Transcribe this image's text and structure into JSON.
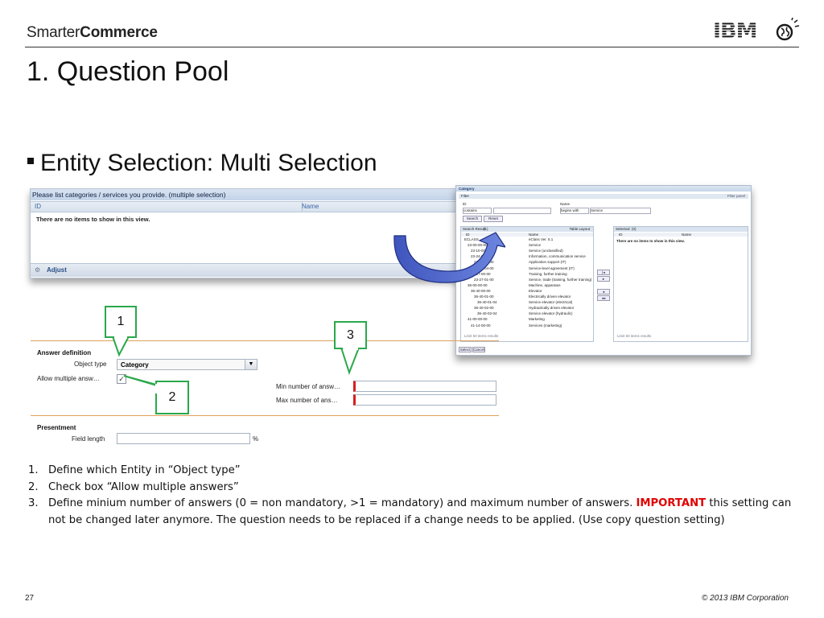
{
  "header": {
    "brand_prefix": "Smarter",
    "brand_suffix": "Commerce",
    "ibm_logo_text": "IBM"
  },
  "title": "1. Question Pool",
  "bullet": "Entity Selection: Multi Selection",
  "list_panel": {
    "title": "Please list categories / services you provide. (multiple selection)",
    "columns": [
      "ID",
      "Name"
    ],
    "empty_text": "There are no items to show in this view.",
    "footer_button": "Adjust"
  },
  "category_dialog": {
    "title": "Category",
    "filter_section": "Filter",
    "filter_action": "Filter panel",
    "id_label": "ID",
    "id_operator": "contains",
    "name_label": "Name",
    "name_operator": "begins with",
    "name_value": "Service",
    "search_button": "Search",
    "reset_button": "Reset",
    "search_result_title": "Search Result",
    "search_result_count": "(1)",
    "table_layout": "Table Layout",
    "selected_title": "Selected",
    "selected_count": "(0)",
    "columns": [
      "ID",
      "Name"
    ],
    "rows": [
      {
        "id": "ECLASS",
        "name": "eClass Ver. 5.1"
      },
      {
        "id": "23-00-00-00",
        "name": "Service"
      },
      {
        "id": "23-10-00-00",
        "name": "Service (unclassified)"
      },
      {
        "id": "23-24-00-00",
        "name": "Information, communication service"
      },
      {
        "id": "23-24-01-00",
        "name": "Application support (IT)"
      },
      {
        "id": "23-24-04-00",
        "name": "Service-level agreement (IT)"
      },
      {
        "id": "23-27-00-00",
        "name": "Training, further training"
      },
      {
        "id": "23-27-01-00",
        "name": "Service, trade (training, further training)"
      },
      {
        "id": "36-00-00-00",
        "name": "Machine, apparatus"
      },
      {
        "id": "36-40-00-00",
        "name": "Elevator"
      },
      {
        "id": "36-40-01-00",
        "name": "Electrically driven elevator"
      },
      {
        "id": "36-40-01-04",
        "name": "Service elevator (electrical)"
      },
      {
        "id": "36-40-02-00",
        "name": "Hydraulically driven elevator"
      },
      {
        "id": "36-40-02-04",
        "name": "Service elevator (hydraulic)"
      },
      {
        "id": "41-00-00-00",
        "name": "Marketing"
      },
      {
        "id": "41-14-00-00",
        "name": "Services (marketing)"
      }
    ],
    "selected_empty": "There are no items to show in this view.",
    "list_footer": "Limit 50 items results",
    "move_buttons": [
      "|◂",
      "▸",
      "◂",
      "◂◂"
    ],
    "select_button": "Select",
    "cancel_button": "Cancel"
  },
  "form": {
    "answer_definition": "Answer definition",
    "object_type_label": "Object type",
    "object_type_value": "Category",
    "allow_multiple_label": "Allow multiple answ…",
    "allow_multiple_checked": true,
    "min_label": "Min number of answ…",
    "max_label": "Max number of ans…",
    "presentment": "Presentment",
    "field_length_label": "Field length",
    "field_length_unit": "%"
  },
  "callouts": [
    "1",
    "2",
    "3"
  ],
  "notes": [
    {
      "num": "1.",
      "text": "Define which Entity in “Object type”"
    },
    {
      "num": "2.",
      "text": "Check box “Allow multiple answers”"
    },
    {
      "num": "3.",
      "text_before": "Define minium number of answers (0 = non mandatory, >1 = mandatory) and maximum number of answers. ",
      "important": "IMPORTANT",
      "text_after": " this setting can not be changed later anymore. The question needs to be replaced if a change needs to be applied. (Use copy question setting)"
    }
  ],
  "footer": {
    "page_number": "27",
    "copyright": "© 2013 IBM Corporation"
  },
  "colors": {
    "accent_red": "#e00000",
    "callout_green": "#2aa84a",
    "arrow_blue": "#4a63c8",
    "divider_orange": "#e0a15c"
  }
}
